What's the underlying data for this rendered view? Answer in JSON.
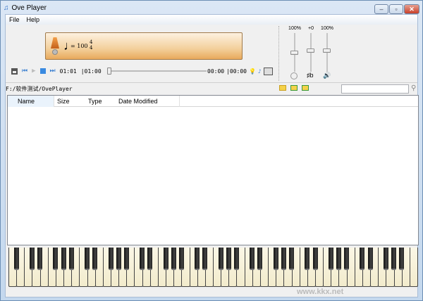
{
  "window": {
    "title": "Ove Player"
  },
  "menu": [
    "File",
    "Help"
  ],
  "display": {
    "tempo": "= 100",
    "time_sig_top": "4",
    "time_sig_bottom": "4"
  },
  "transport": {
    "elapsed": "01:01",
    "total": "|01:00",
    "pos_time": "00:00",
    "pos_total": "|00:00",
    "seek_fraction": 0
  },
  "sliders": [
    {
      "label": "100%",
      "icon": "tempo-clock-icon",
      "level": 0.55
    },
    {
      "label": "+0",
      "icon": "transpose-icon",
      "level": 0.6
    },
    {
      "label": "100%",
      "icon": "volume-icon",
      "level": 0.6
    }
  ],
  "path": "F:/软件测试/OvePlayer",
  "search": {
    "value": ""
  },
  "columns": [
    "Name",
    "Size",
    "Type",
    "Date Modified"
  ],
  "piano": {
    "white_keys": 52,
    "first_key": "A0"
  },
  "watermark": "www.kkx.net"
}
